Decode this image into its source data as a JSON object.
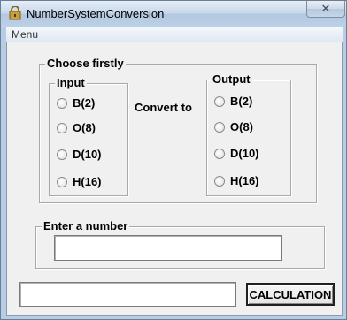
{
  "window": {
    "title": "NumberSystemConversion",
    "close_glyph": "✕"
  },
  "menubar": {
    "items": [
      {
        "label": "Menu"
      }
    ]
  },
  "choose": {
    "label": "Choose firstly",
    "input": {
      "label": "Input",
      "options": [
        "B(2)",
        "O(8)",
        "D(10)",
        "H(16)"
      ]
    },
    "convert_label": "Convert to",
    "output": {
      "label": "Output",
      "options": [
        "B(2)",
        "O(8)",
        "D(10)",
        "H(16)"
      ]
    }
  },
  "enter": {
    "label": "Enter a number",
    "value": ""
  },
  "result": {
    "value": ""
  },
  "calc_button": {
    "label": "CALCULATION"
  }
}
